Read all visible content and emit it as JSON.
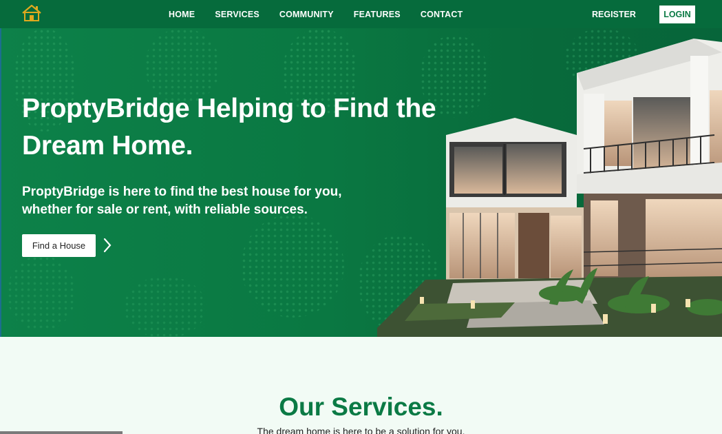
{
  "nav": {
    "links": [
      "HOME",
      "SERVICES",
      "COMMUNITY",
      "FEATURES",
      "CONTACT"
    ],
    "register": "REGISTER",
    "login": "LOGIN"
  },
  "hero": {
    "title": "ProptyBridge Helping to Find the Dream Home.",
    "subtitle": "ProptyBridge is here to find the best house for you, whether for sale or rent, with reliable sources.",
    "cta": "Find a House"
  },
  "services": {
    "title": "Our Services.",
    "subtitle": "The dream home is here to be a solution for you."
  },
  "colors": {
    "brand_green": "#0b7a45",
    "nav_bg": "#066b3c",
    "section_bg": "#f2fbf5",
    "logo_accent": "#e0a91e"
  },
  "icons": [
    "house-logo-icon",
    "chevron-right-icon"
  ]
}
